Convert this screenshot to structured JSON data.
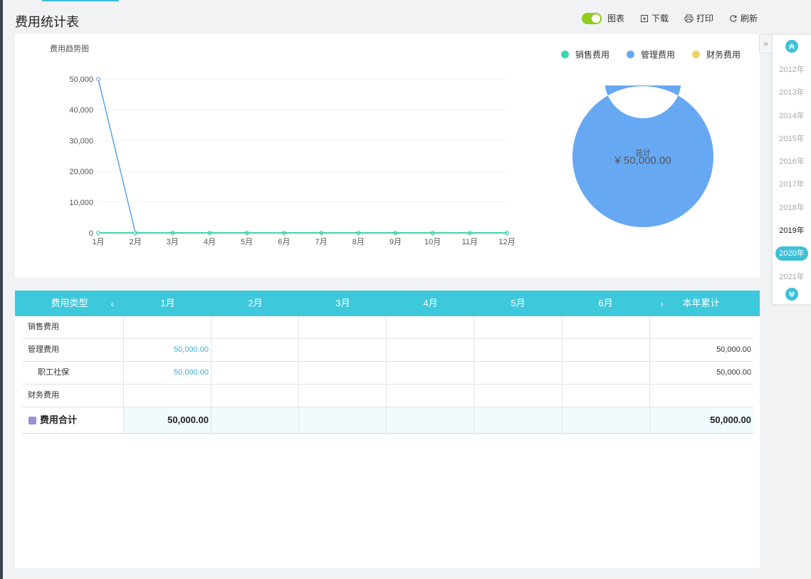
{
  "page": {
    "title": "费用统计表"
  },
  "toolbar": {
    "chart_toggle_label": "图表",
    "download_label": "下载",
    "print_label": "打印",
    "refresh_label": "刷新",
    "chart_toggle_on": true
  },
  "trend_chart": {
    "title": "费用趋势图"
  },
  "legend": [
    {
      "label": "销售费用",
      "color": "#3fd4ac"
    },
    {
      "label": "管理费用",
      "color": "#67a8f3"
    },
    {
      "label": "财务费用",
      "color": "#f2d06b"
    }
  ],
  "donut": {
    "center_label": "总计",
    "center_value": "¥ 50,000.00"
  },
  "years": {
    "items": [
      "2012年",
      "2013年",
      "2014年",
      "2015年",
      "2016年",
      "2017年",
      "2018年",
      "2019年",
      "2020年",
      "2021年"
    ],
    "current": "2019年",
    "selected": "2020年"
  },
  "table": {
    "headers": [
      "费用类型",
      "1月",
      "2月",
      "3月",
      "4月",
      "5月",
      "6月",
      "本年累计"
    ],
    "rows": [
      {
        "label": "销售费用",
        "indent": false,
        "cells": [
          "",
          "",
          "",
          "",
          "",
          ""
        ],
        "total": ""
      },
      {
        "label": "管理费用",
        "indent": false,
        "cells": [
          "50,000.00",
          "",
          "",
          "",
          "",
          ""
        ],
        "total": "50,000.00"
      },
      {
        "label": "职工社保",
        "indent": true,
        "cells": [
          "50,000.00",
          "",
          "",
          "",
          "",
          ""
        ],
        "total": "50,000.00"
      },
      {
        "label": "财务费用",
        "indent": false,
        "cells": [
          "",
          "",
          "",
          "",
          "",
          ""
        ],
        "total": ""
      }
    ],
    "total_row": {
      "label": "费用合计",
      "cells": [
        "50,000.00",
        "",
        "",
        "",
        "",
        ""
      ],
      "total": "50,000.00"
    }
  },
  "chart_data": [
    {
      "type": "line",
      "title": "费用趋势图",
      "x": [
        "1月",
        "2月",
        "3月",
        "4月",
        "5月",
        "6月",
        "7月",
        "8月",
        "9月",
        "10月",
        "11月",
        "12月"
      ],
      "ylim": [
        0,
        50000
      ],
      "y_ticks": [
        "0",
        "10,000",
        "20,000",
        "30,000",
        "40,000",
        "50,000"
      ],
      "grid": true,
      "series": [
        {
          "name": "销售费用",
          "color": "#3fd4ac",
          "values": [
            0,
            0,
            0,
            0,
            0,
            0,
            0,
            0,
            0,
            0,
            0,
            0
          ]
        },
        {
          "name": "管理费用",
          "color": "#67a8f3",
          "values": [
            50000,
            0,
            0,
            0,
            0,
            0,
            0,
            0,
            0,
            0,
            0,
            0
          ]
        },
        {
          "name": "财务费用",
          "color": "#f2d06b",
          "values": [
            0,
            0,
            0,
            0,
            0,
            0,
            0,
            0,
            0,
            0,
            0,
            0
          ]
        }
      ]
    },
    {
      "type": "pie",
      "categories": [
        "销售费用",
        "管理费用",
        "财务费用"
      ],
      "values": [
        0,
        50000,
        0
      ],
      "colors": [
        "#3fd4ac",
        "#67a8f3",
        "#f2d06b"
      ]
    }
  ]
}
